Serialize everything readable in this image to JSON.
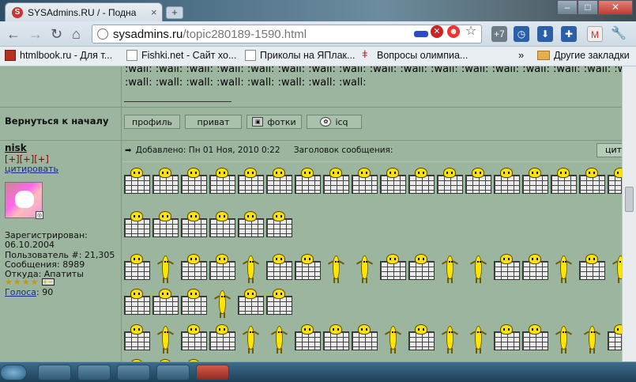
{
  "browser": {
    "tab_title": "SYSAdmins.RU / - Подна",
    "tab_close": "×",
    "new_tab": "+",
    "window_buttons": [
      "–",
      "□",
      "✕"
    ],
    "url_host": "sysadmins.ru",
    "url_path": "/topic280189-1590.html"
  },
  "bookmarks": {
    "items": [
      "htmlbook.ru - Для т...",
      "Fishki.net - Сайт хо...",
      "Приколы на ЯПлак...",
      "Вопросы олимпиа..."
    ],
    "more": "»",
    "other": "Другие закладки"
  },
  "post_prev": {
    "wall_line_1": ":wall: :wall: :wall: :wall: :wall: :wall: :wall: :wall: :wall: :wall: :wall: :wall: :wall: :wall: :wall: :wall: :wall:",
    "wall_line_2": ":wall: :wall: :wall: :wall: :wall: :wall: :wall: :wall:",
    "back_to_top": "Вернуться к началу",
    "buttons": [
      "профиль",
      "приват",
      "фотки",
      "icq"
    ]
  },
  "user": {
    "name": "nisk",
    "ranks": "[+][+][+]",
    "quote_link": "цитировать",
    "registered_label": "Зарегистрирован:",
    "registered_date": "06.10.2004",
    "user_number": "Пользователь #: 21,305",
    "messages": "Сообщения: 8989",
    "location": "Откуда: Апатиты",
    "votes_label": "Голоса",
    "votes_value": ": 90"
  },
  "post": {
    "posted": "Добавлено: Пн 01 Ноя, 2010 0:22",
    "subject_label": "Заголовок сообщения:",
    "quote_button": "цит",
    "rows": [
      "WWWWWWWWWWWWWWWWWW",
      "WWWWWW",
      "WBWWBWWBBWWBBWWBWB",
      "WWWBWW",
      "WBWWBBWWWBWBBWWBBW",
      "WWW"
    ]
  }
}
